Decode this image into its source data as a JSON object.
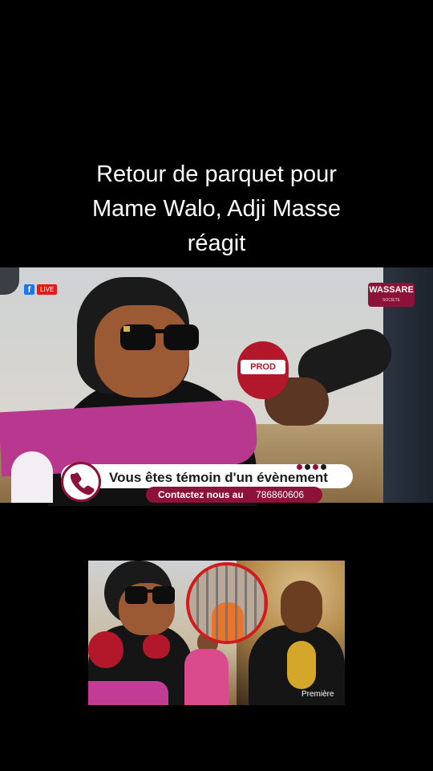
{
  "caption": {
    "line1": "Retour de parquet pour",
    "line2": "Mame Walo, Adji Masse",
    "line3": "réagit"
  },
  "video": {
    "live_label": "LIVE",
    "facebook_letter": "f",
    "brand": "WASSARE",
    "brand_sub": "SOCIETE",
    "mic_label": "PROD",
    "banner_text": "Vous êtes témoin d'un évènement",
    "contact_label": "Contactez nous au",
    "contact_number": "786860606",
    "phone_icon": "phone-icon"
  },
  "thumbnail": {
    "overlay_text": "Première"
  },
  "colors": {
    "background": "#000000",
    "brand": "#8c1239",
    "live": "#e21b1b",
    "facebook": "#1877f2"
  }
}
